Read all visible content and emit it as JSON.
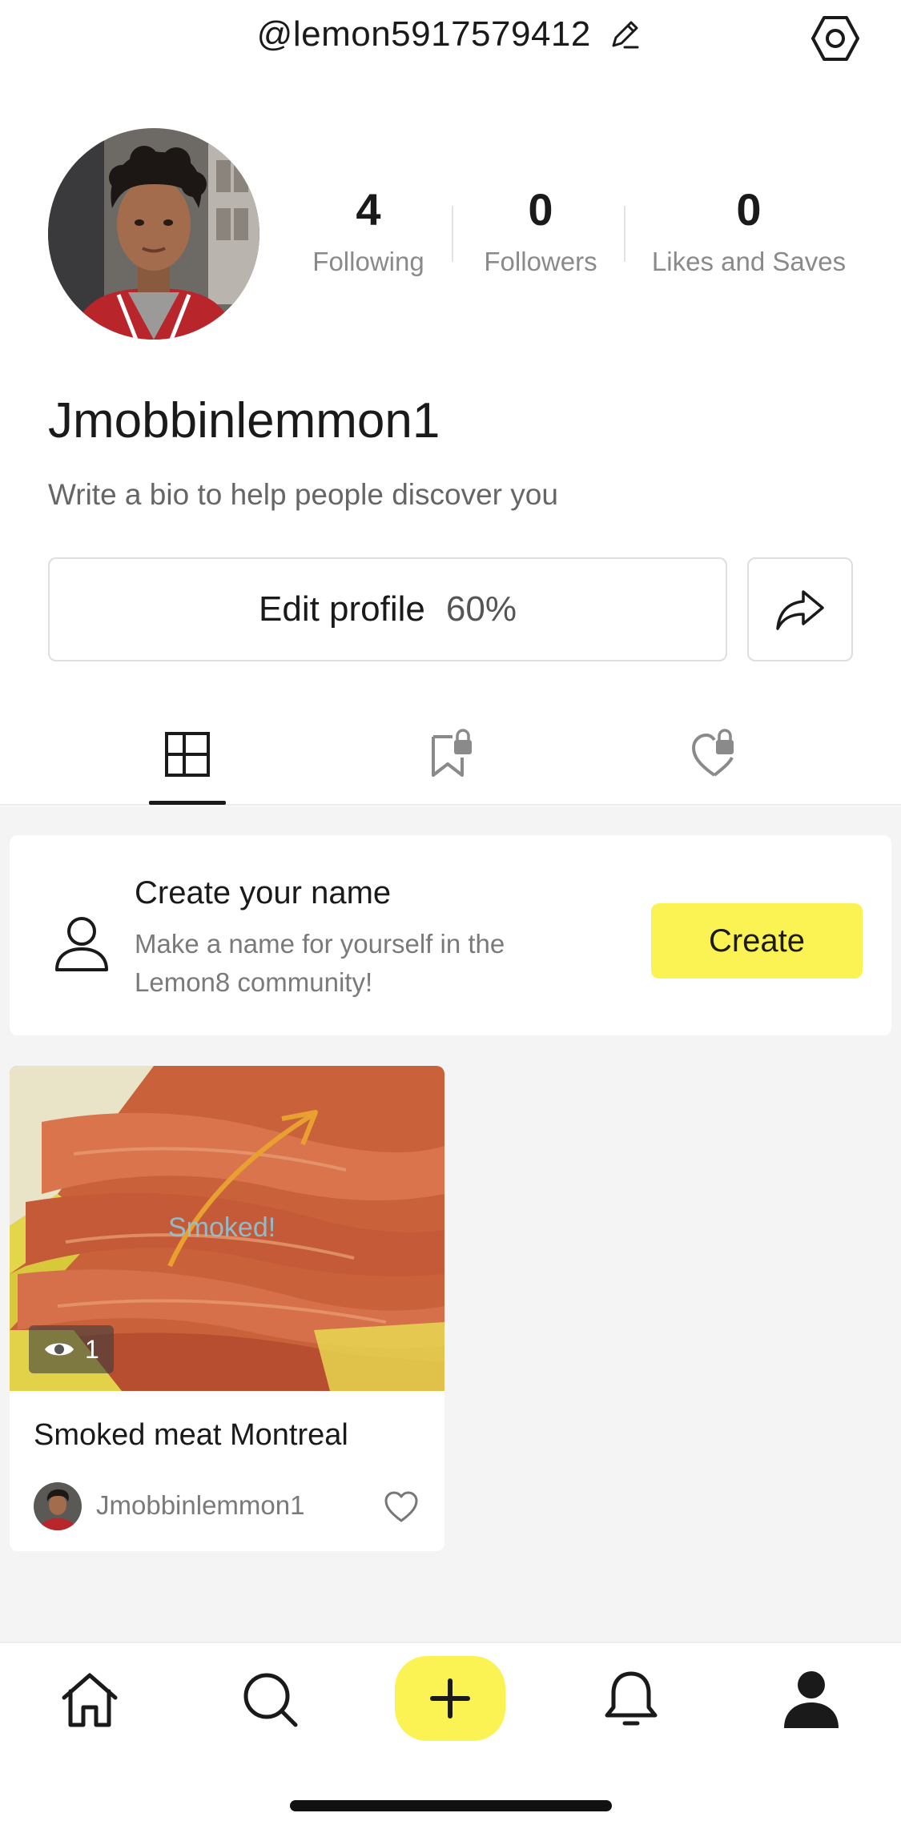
{
  "header": {
    "handle": "@lemon5917579412"
  },
  "profile": {
    "display_name": "Jmobbinlemmon1",
    "bio_placeholder": "Write a bio to help people discover you",
    "stats": [
      {
        "value": "4",
        "label": "Following"
      },
      {
        "value": "0",
        "label": "Followers"
      },
      {
        "value": "0",
        "label": "Likes and Saves"
      }
    ],
    "edit_profile_label": "Edit profile",
    "edit_profile_progress": "60%"
  },
  "tabs": [
    "posts-grid-icon",
    "saved-locked-icon",
    "liked-locked-icon"
  ],
  "create_card": {
    "title": "Create your name",
    "subtitle": "Make a name for yourself in the Lemon8 community!",
    "button_label": "Create"
  },
  "posts": [
    {
      "image_text": "Smoked!",
      "views": "1",
      "title": "Smoked meat Montreal",
      "author": "Jmobbinlemmon1"
    }
  ],
  "bottom_nav": [
    "home-icon",
    "search-icon",
    "plus-icon",
    "bell-icon",
    "profile-icon"
  ],
  "colors": {
    "accent_yellow": "#fbf353",
    "text_primary": "#1a1a1a",
    "text_secondary": "#8a8a8a",
    "feed_bg": "#f4f4f4"
  }
}
